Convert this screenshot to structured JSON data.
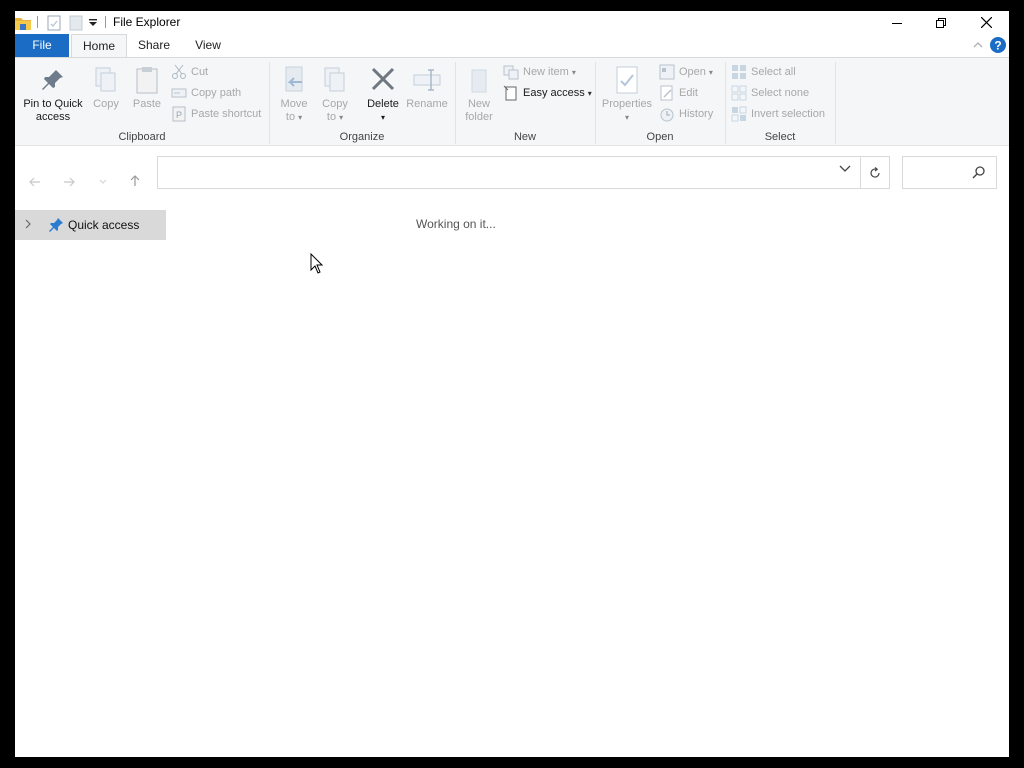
{
  "window": {
    "title": "File Explorer",
    "quick_access_toolbar": {
      "icons": [
        "folder-icon",
        "properties-icon",
        "new-folder-icon",
        "customize-dropdown-icon"
      ]
    },
    "controls": [
      "minimize-icon",
      "restore-icon",
      "close-icon"
    ]
  },
  "ribbon": {
    "tabs": [
      {
        "label": "File",
        "style": "file"
      },
      {
        "label": "Home",
        "active": true
      },
      {
        "label": "Share"
      },
      {
        "label": "View"
      }
    ],
    "help_icon": "help-icon",
    "collapse_icon": "chevron-up-icon",
    "groups": {
      "clipboard": {
        "label": "Clipboard",
        "pin_label_1": "Pin to Quick",
        "pin_label_2": "access",
        "copy": "Copy",
        "paste": "Paste",
        "cut": "Cut",
        "copy_path": "Copy path",
        "paste_shortcut": "Paste shortcut"
      },
      "organize": {
        "label": "Organize",
        "move_to_1": "Move",
        "move_to_2": "to",
        "copy_to_1": "Copy",
        "copy_to_2": "to",
        "delete": "Delete",
        "rename": "Rename"
      },
      "new": {
        "label": "New",
        "new_folder_1": "New",
        "new_folder_2": "folder",
        "new_item": "New item",
        "easy_access": "Easy access"
      },
      "open": {
        "label": "Open",
        "properties": "Properties",
        "open": "Open",
        "edit": "Edit",
        "history": "History"
      },
      "select": {
        "label": "Select",
        "select_all": "Select all",
        "select_none": "Select none",
        "invert_selection": "Invert selection"
      }
    }
  },
  "navigation": {
    "address_value": "",
    "search_value": ""
  },
  "sidebar": {
    "items": [
      {
        "label": "Quick access",
        "icon": "pin-icon",
        "expanded": false
      }
    ]
  },
  "content": {
    "status": "Working on it..."
  },
  "colors": {
    "accent": "#1a6cc4",
    "ribbon_bg": "#f5f6f7",
    "selected_bg": "#d9d9d9"
  }
}
